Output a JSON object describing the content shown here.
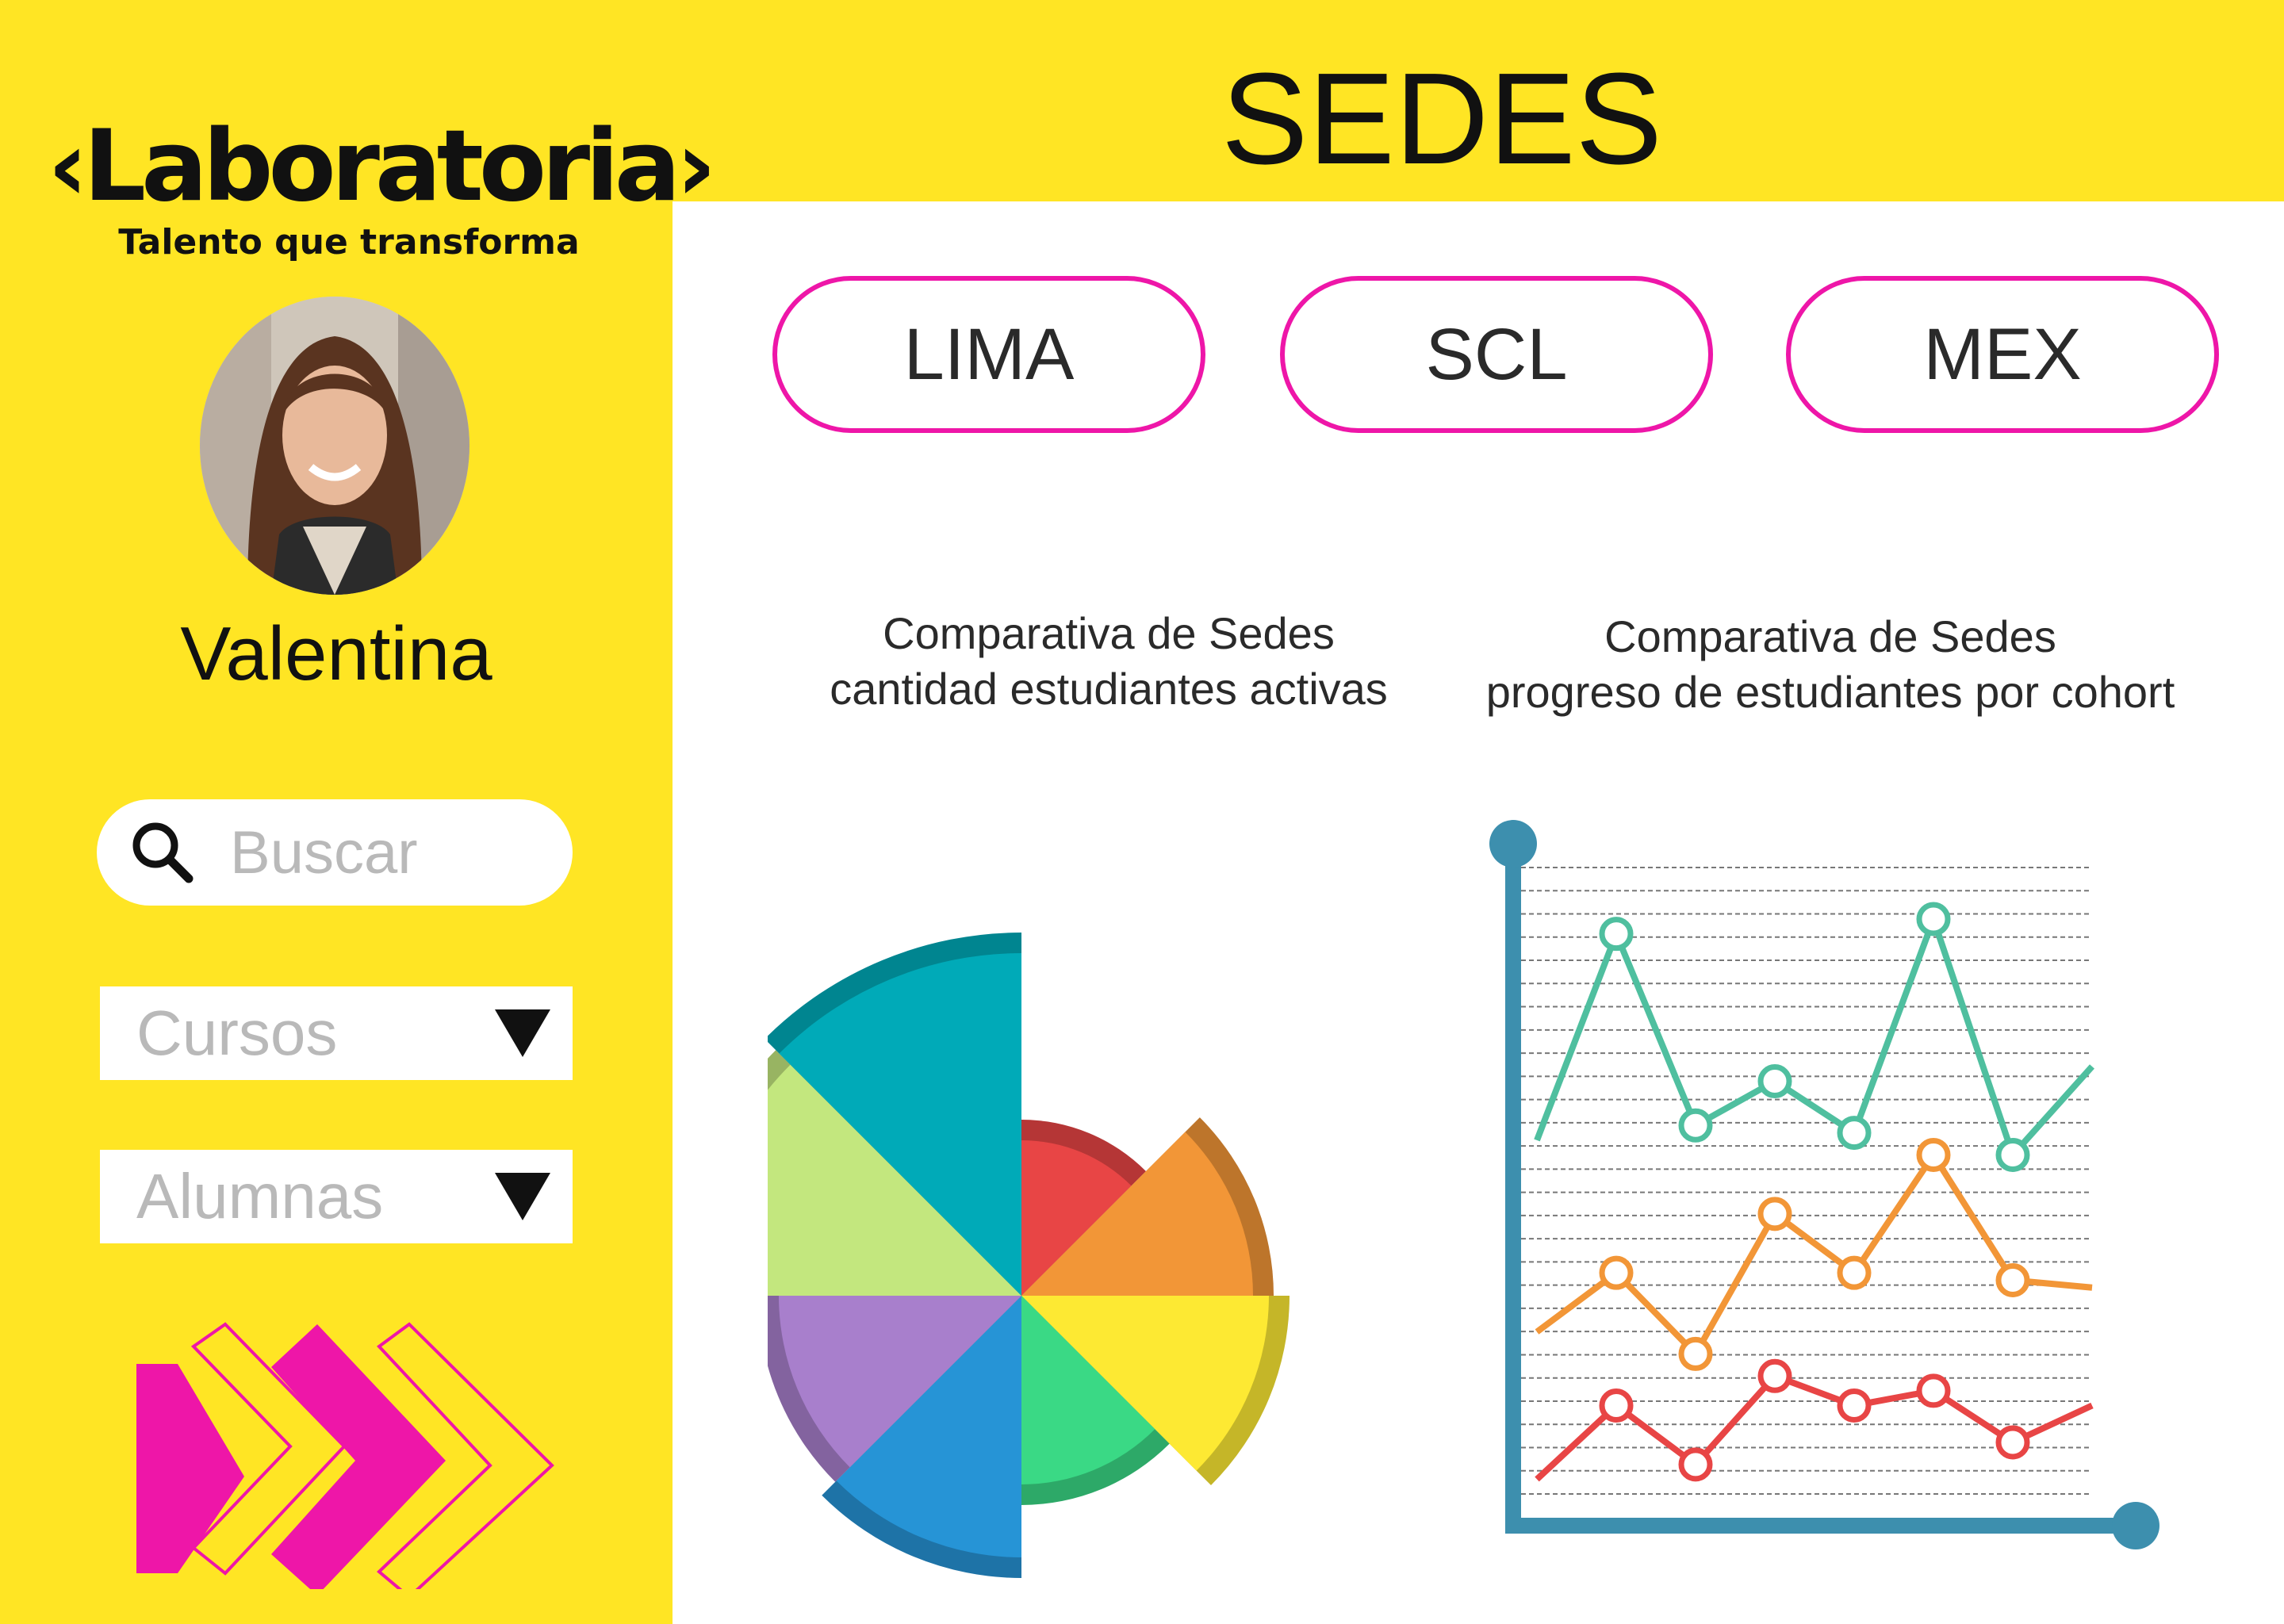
{
  "header": {
    "title": "SEDES"
  },
  "brand": {
    "name": "‹Laboratoria›",
    "tagline": "Talento que transforma"
  },
  "user": {
    "name": "Valentina"
  },
  "search": {
    "placeholder": "Buscar"
  },
  "filters": [
    {
      "label": "Cursos"
    },
    {
      "label": "Alumnas"
    }
  ],
  "campuses": [
    "LIMA",
    "SCL",
    "MEX"
  ],
  "colors": {
    "accent": "#ee16a8",
    "background": "#ffe524",
    "panel": "#ffffff"
  },
  "chart_data": [
    {
      "type": "pie",
      "title": "Comparativa de Sedes\ncantidad estudiantes activas",
      "slices": [
        {
          "value": 1,
          "color": "#e84545"
        },
        {
          "value": 1,
          "color": "#f29637"
        },
        {
          "value": 1,
          "color": "#fde933"
        },
        {
          "value": 1,
          "color": "#3ad985"
        },
        {
          "value": 1,
          "color": "#2694d6"
        },
        {
          "value": 1,
          "color": "#a87fcc"
        },
        {
          "value": 1,
          "color": "#c3e77e"
        },
        {
          "value": 1,
          "color": "#00aab8"
        }
      ]
    },
    {
      "type": "line",
      "title": "Comparativa de Sedes\nprogreso de estudiantes por cohort",
      "grid": true,
      "series": [
        {
          "color": "#4fbf9f",
          "values": [
            48,
            76,
            50,
            56,
            49,
            78,
            46,
            58
          ]
        },
        {
          "color": "#f29637",
          "values": [
            22,
            30,
            19,
            38,
            30,
            46,
            29,
            28
          ]
        },
        {
          "color": "#e84545",
          "values": [
            2,
            12,
            4,
            16,
            12,
            14,
            7,
            12
          ]
        }
      ]
    }
  ]
}
